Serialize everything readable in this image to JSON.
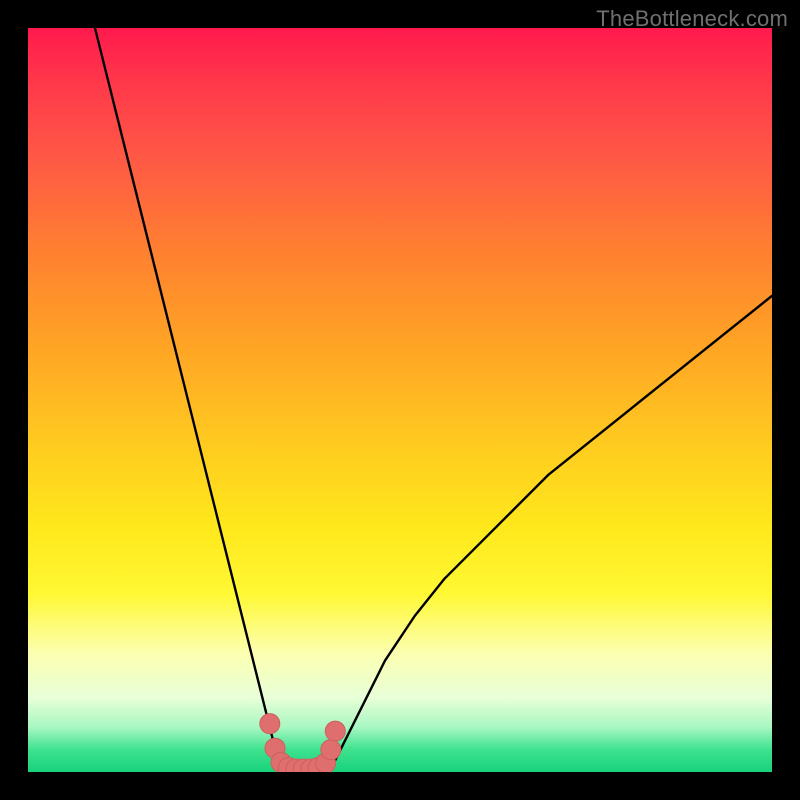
{
  "watermark": {
    "text": "TheBottleneck.com"
  },
  "colors": {
    "frame": "#000000",
    "curve_stroke": "#000000",
    "marker_fill": "#de6f6e",
    "marker_stroke": "#cf5f5d"
  },
  "chart_data": {
    "type": "line",
    "title": "",
    "xlabel": "",
    "ylabel": "",
    "xlim": [
      0,
      100
    ],
    "ylim": [
      0,
      100
    ],
    "grid": false,
    "legend": false,
    "series": [
      {
        "name": "curve",
        "x": [
          9,
          11,
          13,
          15,
          17,
          19,
          21,
          23,
          25,
          26,
          27,
          28,
          29,
          30,
          31,
          32,
          33,
          33.5,
          34,
          35,
          36,
          37,
          38,
          39,
          40,
          41,
          42,
          43,
          44,
          46,
          48,
          52,
          56,
          60,
          65,
          70,
          75,
          80,
          85,
          90,
          95,
          100
        ],
        "y": [
          100,
          92,
          84,
          76,
          68,
          60,
          52,
          44,
          36,
          32,
          28,
          24,
          20,
          16,
          12,
          8,
          4,
          2,
          0,
          0,
          0,
          0,
          0,
          0,
          0,
          1,
          3,
          5,
          7,
          11,
          15,
          21,
          26,
          30,
          35,
          40,
          44,
          48,
          52,
          56,
          60,
          64
        ]
      }
    ],
    "markers": {
      "name": "highlight",
      "x": [
        32.5,
        33.2,
        34,
        35,
        36,
        37,
        38,
        39,
        40,
        40.7,
        41.3
      ],
      "y": [
        6.5,
        3.2,
        1.3,
        0.6,
        0.4,
        0.4,
        0.4,
        0.6,
        1.2,
        3.0,
        5.5
      ]
    }
  }
}
